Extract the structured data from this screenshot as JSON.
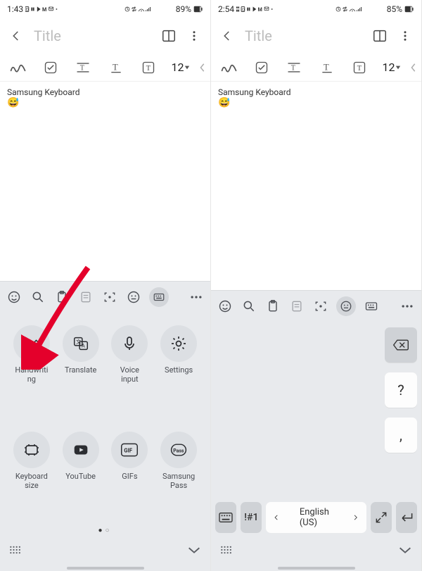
{
  "left": {
    "status": {
      "time": "1:43",
      "battery": "89%"
    },
    "header": {
      "title_placeholder": "Title"
    },
    "toolbar": {
      "font_size": "12"
    },
    "note": {
      "text": "Samsung Keyboard"
    },
    "kbd_apps": [
      {
        "label": "Handwriti\nng"
      },
      {
        "label": "Translate"
      },
      {
        "label": "Voice\ninput"
      },
      {
        "label": "Settings"
      },
      {
        "label": "Keyboard\nsize"
      },
      {
        "label": "YouTube"
      },
      {
        "label": "GIFs"
      },
      {
        "label": "Samsung\nPass"
      }
    ]
  },
  "right": {
    "status": {
      "time": "2:54",
      "battery": "85%"
    },
    "header": {
      "title_placeholder": "Title"
    },
    "toolbar": {
      "font_size": "12"
    },
    "note": {
      "text": "Samsung Keyboard"
    },
    "lang": {
      "label": "English (US)",
      "sym": "!#1"
    },
    "side_keys": {
      "q": "?",
      "comma": ","
    }
  }
}
